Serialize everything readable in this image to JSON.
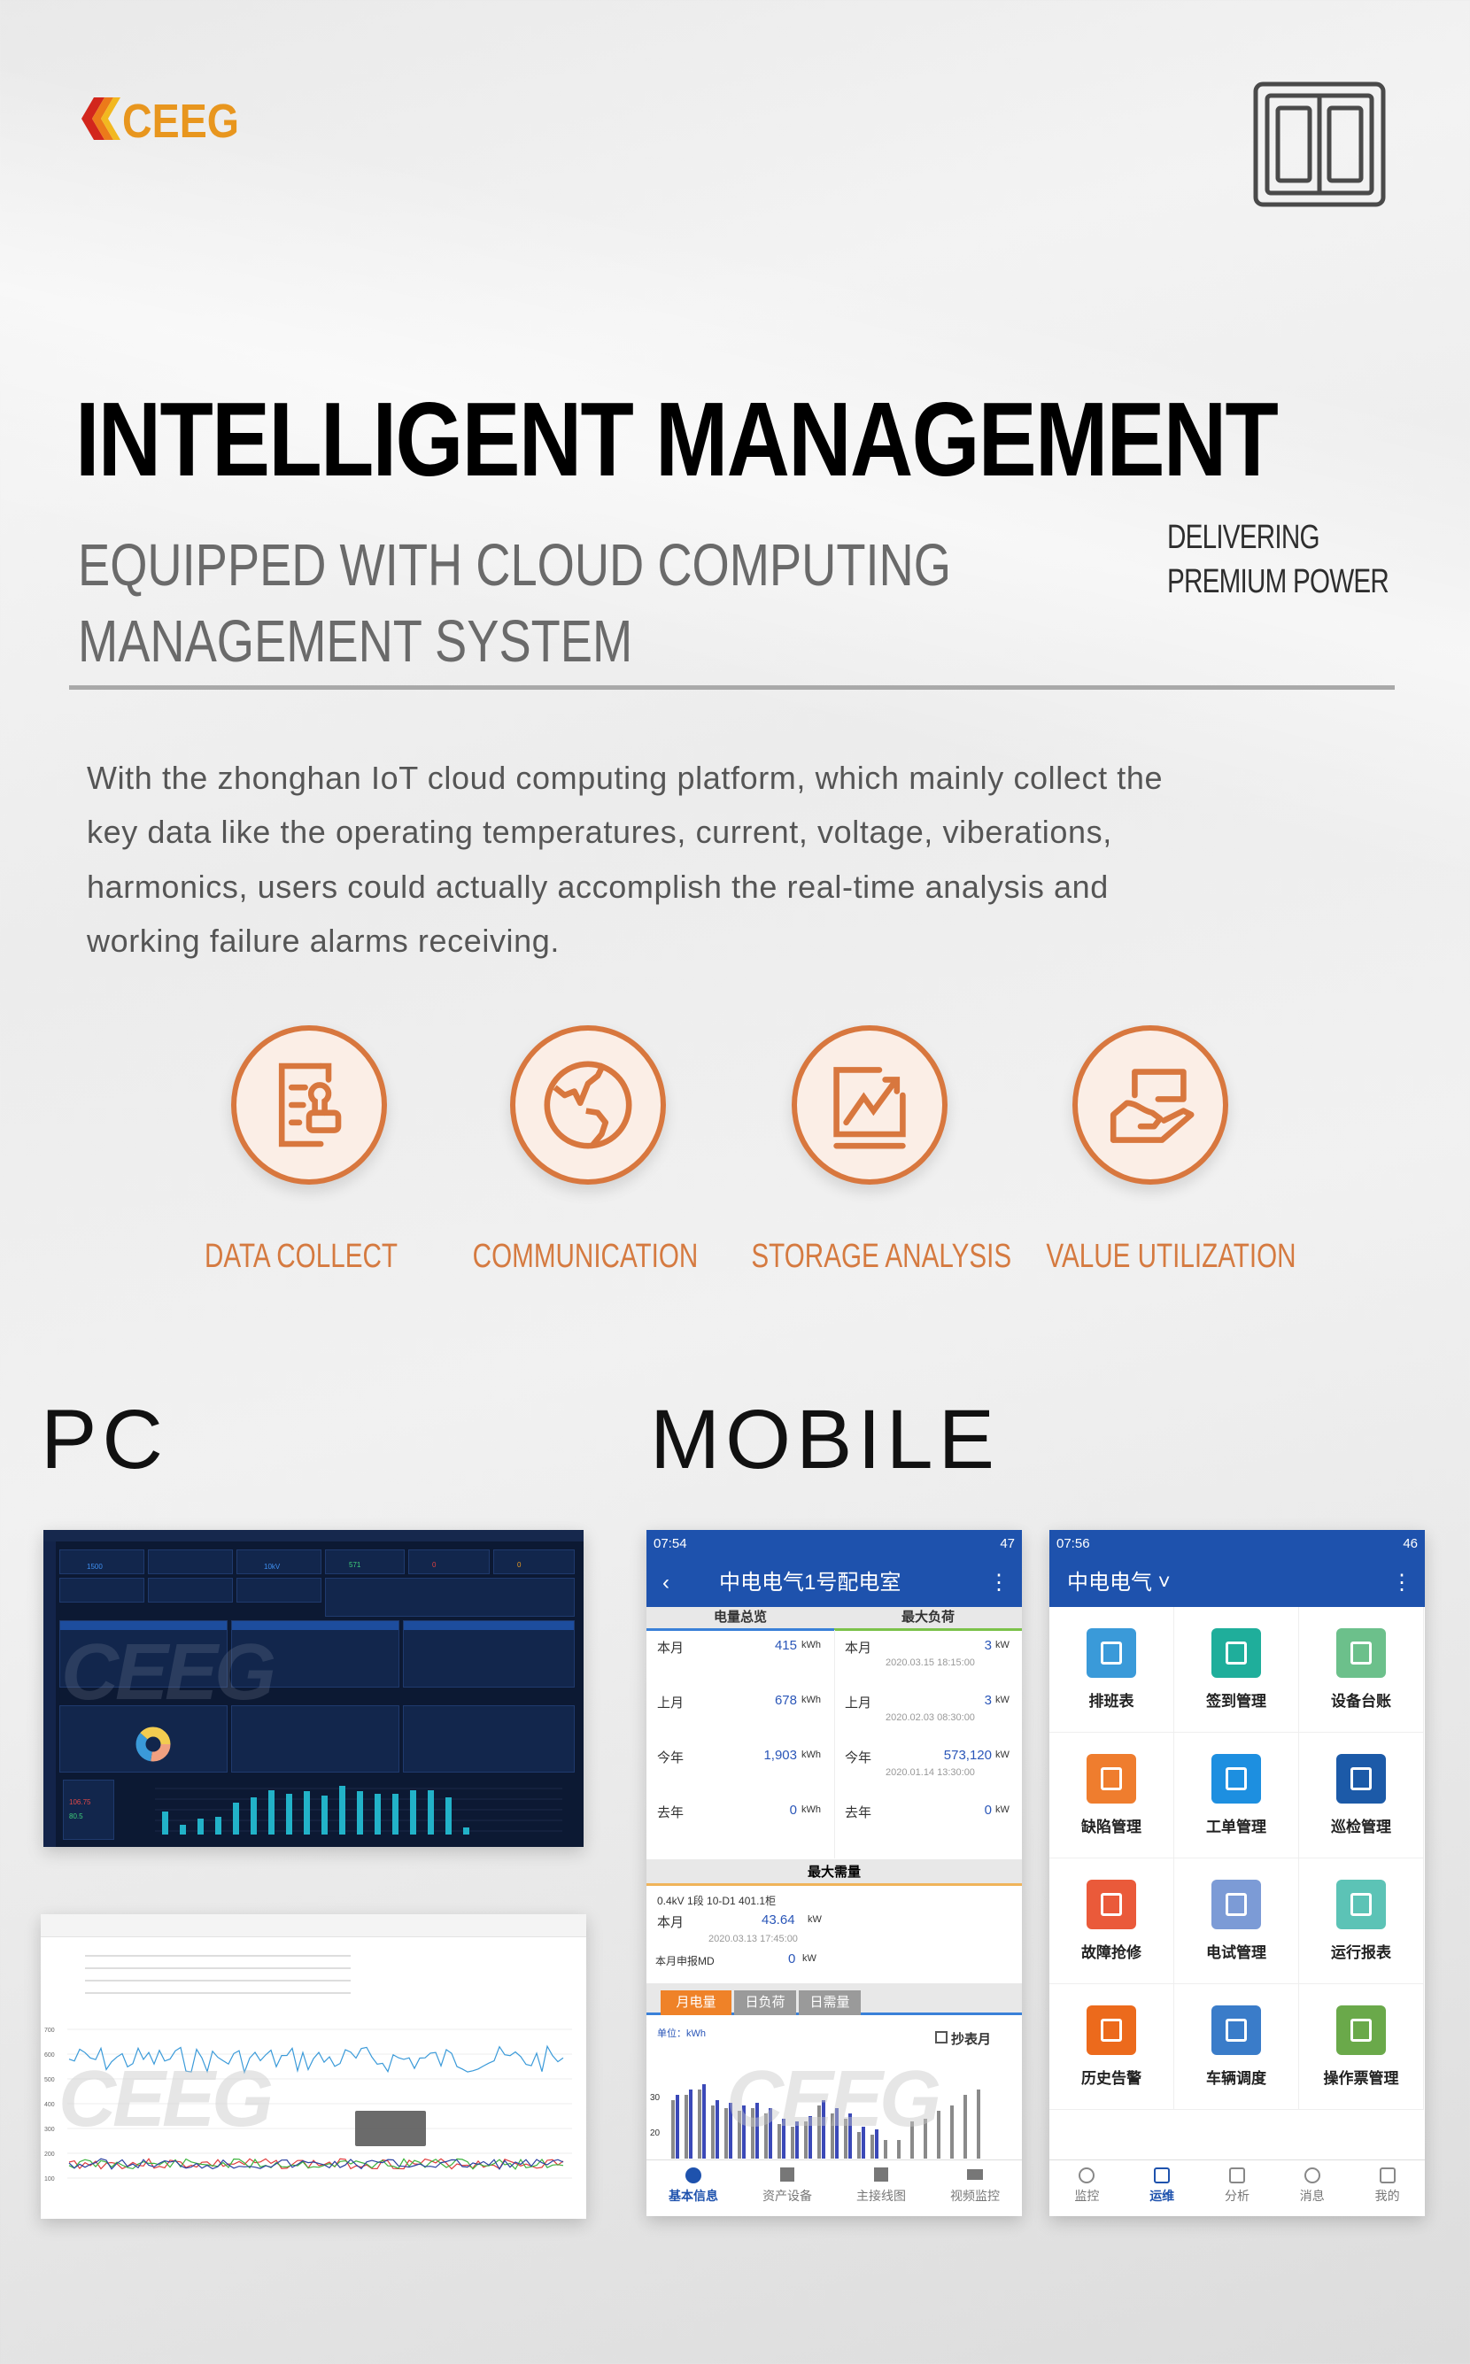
{
  "brand": {
    "logo_text": "CEEG",
    "logo_colors": [
      "#d2261c",
      "#ec7a1a",
      "#f2b820"
    ],
    "accent": "#d8773e"
  },
  "header": {
    "door_icon": "double-door-icon"
  },
  "hero": {
    "title": "INTELLIGENT MANAGEMENT",
    "subtitle_lines": [
      "EQUIPPED WITH CLOUD COMPUTING",
      "MANAGEMENT SYSTEM"
    ],
    "tagline_lines": [
      "DELIVERING",
      "PREMIUM POWER"
    ]
  },
  "description_lines": [
    "With the zhonghan IoT cloud computing platform,  which mainly collect the",
    "key data like the operating temperatures, current, voltage, viberations,",
    "harmonics, users could actually accomplish the real-time analysis and",
    "working failure alarms receiving."
  ],
  "features": [
    {
      "label": "DATA COLLECT",
      "icon": "document-stamp-icon"
    },
    {
      "label": "COMMUNICATION",
      "icon": "globe-icon"
    },
    {
      "label": "STORAGE ANALYSIS",
      "icon": "chart-trend-icon"
    },
    {
      "label": "VALUE UTILIZATION",
      "icon": "hand-card-icon"
    }
  ],
  "sections": {
    "pc": "PC",
    "mobile": "MOBILE"
  },
  "pc_dashboard": {
    "values": [
      "1500",
      "10kV",
      "571",
      "0",
      "0",
      "106.75",
      "80.5"
    ]
  },
  "pc_chart": {
    "yticks": [
      "700",
      "600",
      "500",
      "400",
      "300",
      "200",
      "100"
    ]
  },
  "mobile1": {
    "time": "07:54",
    "battery": "47",
    "title": "中电电气1号配电室",
    "tabs": [
      "电量总览",
      "最大负荷"
    ],
    "energy": [
      {
        "label": "本月",
        "value": "415",
        "unit": "kWh"
      },
      {
        "label": "上月",
        "value": "678",
        "unit": "kWh"
      },
      {
        "label": "今年",
        "value": "1,903",
        "unit": "kWh"
      },
      {
        "label": "去年",
        "value": "0",
        "unit": "kWh"
      }
    ],
    "load": [
      {
        "label": "本月",
        "value": "3",
        "unit": "kW",
        "time": "2020.03.15 18:15:00"
      },
      {
        "label": "上月",
        "value": "3",
        "unit": "kW",
        "time": "2020.02.03 08:30:00"
      },
      {
        "label": "今年",
        "value": "573,120",
        "unit": "kW",
        "time": "2020.01.14 13:30:00"
      },
      {
        "label": "去年",
        "value": "0",
        "unit": "kW",
        "time": ""
      }
    ],
    "demand_title": "最大需量",
    "demand_device": "0.4kV 1段 10-D1 401.1柜",
    "demand_month_label": "本月",
    "demand_month_value": "43.64",
    "demand_month_unit": "kW",
    "demand_time": "2020.03.13 17:45:00",
    "declared_label": "本月申报MD",
    "declared_value": "0",
    "declared_unit": "kW",
    "chart_tabs": [
      "月电量",
      "日负荷",
      "日需量"
    ],
    "unit_label": "单位：kWh",
    "checkbox_label": "抄表月",
    "yticks": [
      "30",
      "20"
    ],
    "nav": [
      "基本信息",
      "资产设备",
      "主接线图",
      "视频监控"
    ]
  },
  "mobile2": {
    "time": "07:56",
    "battery": "46",
    "title": "中电电气 ˅",
    "modules": [
      {
        "label": "排班表",
        "color": "#3a9ad9"
      },
      {
        "label": "签到管理",
        "color": "#1fae9b"
      },
      {
        "label": "设备台账",
        "color": "#6cc08b"
      },
      {
        "label": "缺陷管理",
        "color": "#ef7d2e"
      },
      {
        "label": "工单管理",
        "color": "#1d8fe0"
      },
      {
        "label": "巡检管理",
        "color": "#1c5aa8"
      },
      {
        "label": "故障抢修",
        "color": "#ea5a3a"
      },
      {
        "label": "电试管理",
        "color": "#7c9bd6"
      },
      {
        "label": "运行报表",
        "color": "#5cc3b6"
      },
      {
        "label": "历史告警",
        "color": "#ec6a1c"
      },
      {
        "label": "车辆调度",
        "color": "#3a7cc9"
      },
      {
        "label": "操作票管理",
        "color": "#6aa94a"
      }
    ],
    "nav": [
      "监控",
      "运维",
      "分析",
      "消息",
      "我的"
    ]
  }
}
